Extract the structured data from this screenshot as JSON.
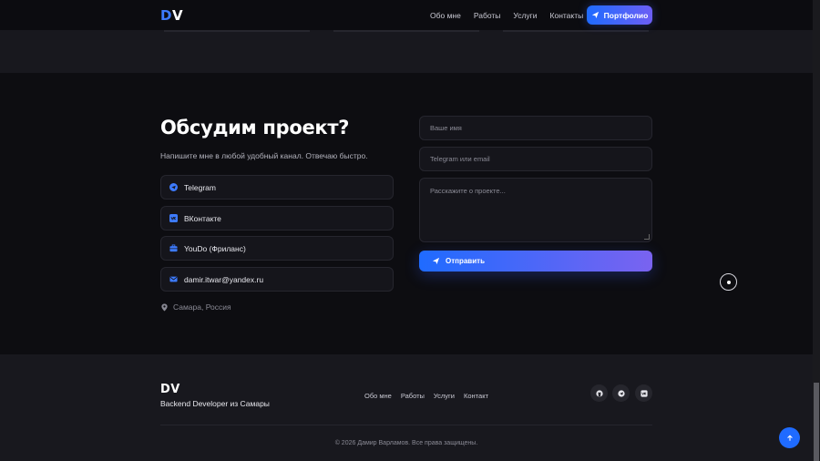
{
  "header": {
    "logo_d": "D",
    "logo_v": "V",
    "nav": [
      "Обо мне",
      "Работы",
      "Услуги",
      "Контакты"
    ],
    "portfolio_label": "Портфолио"
  },
  "contact": {
    "title": "Обсудим проект?",
    "subtitle": "Напишите мне в любой удобный канал. Отвечаю быстро.",
    "channels": [
      {
        "label": "Telegram",
        "icon": "telegram-icon"
      },
      {
        "label": "ВКонтакте",
        "icon": "vk-icon"
      },
      {
        "label": "YouDo (Фриланс)",
        "icon": "briefcase-icon"
      },
      {
        "label": "damir.itwar@yandex.ru",
        "icon": "mail-icon"
      }
    ],
    "location": "Самара, Россия"
  },
  "form": {
    "name_placeholder": "Ваше имя",
    "contact_placeholder": "Telegram или email",
    "message_placeholder": "Расскажите о проекте...",
    "submit_label": "Отправить"
  },
  "footer": {
    "logo": "DV",
    "tagline": "Backend Developer из Самары",
    "nav": [
      "Обо мне",
      "Работы",
      "Услуги",
      "Контакт"
    ],
    "copyright": "© 2026 Дамир Варламов. Все права защищены."
  },
  "colors": {
    "accent": "#1f6bff",
    "accent_end": "#6c5ef5",
    "background": "#0d0d11",
    "panel": "#18181e"
  }
}
